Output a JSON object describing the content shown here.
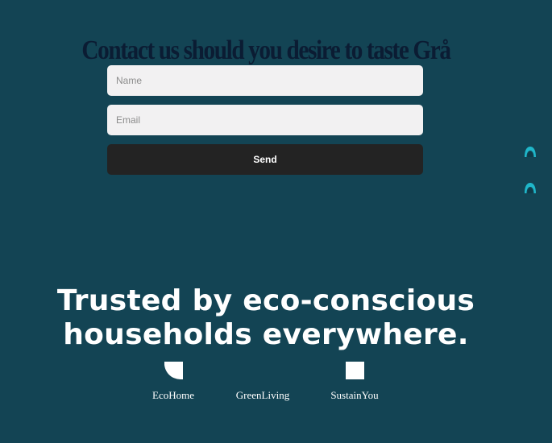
{
  "contact": {
    "title": "Contact us should you desire to taste Grå",
    "name_placeholder": "Name",
    "email_placeholder": "Email",
    "send_label": "Send"
  },
  "side_icons": [
    {
      "icon": "wave-drop-icon",
      "color": "#1fb6c9"
    },
    {
      "icon": "wave-drop-icon",
      "color": "#1fb6c9"
    }
  ],
  "trusted": {
    "line1": "Trusted by eco-conscious",
    "line2": "households everywhere."
  },
  "logos": [
    {
      "name": "EcoHome",
      "icon": "quarter-circle-logo-icon"
    },
    {
      "name": "GreenLiving",
      "icon": "blank-logo-icon"
    },
    {
      "name": "SustainYou",
      "icon": "square-logo-icon"
    }
  ],
  "colors": {
    "background": "#134454",
    "title": "#0b1c33",
    "input_bg": "#f2f1f2",
    "button_bg": "#232323",
    "accent": "#1fb6c9",
    "text_light": "#ffffff"
  }
}
